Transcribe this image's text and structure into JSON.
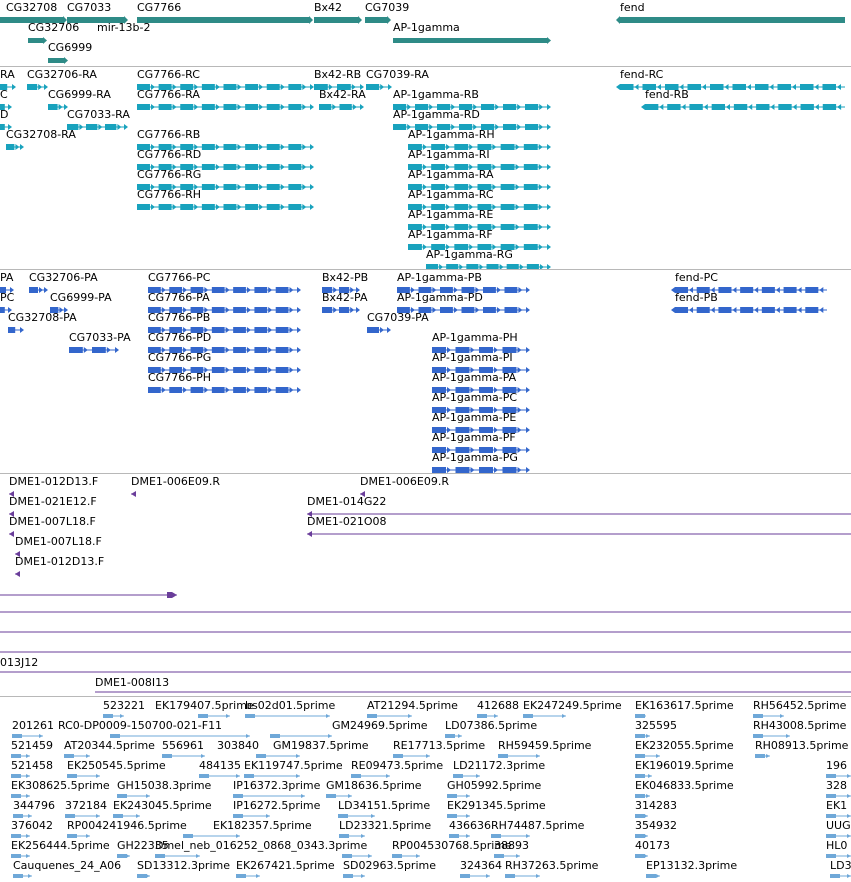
{
  "colors": {
    "gene": "#2e8b87",
    "transcript": "#18a2bd",
    "protein": "#3366cc",
    "clone": "#6a3d9a",
    "est": "#6fa8d8"
  },
  "tracks": {
    "genes": {
      "labels": [
        {
          "t": "CG32708"
        },
        {
          "t": "CG7033"
        },
        {
          "t": "CG7766"
        },
        {
          "t": "Bx42"
        },
        {
          "t": "CG7039"
        },
        {
          "t": "fend"
        },
        {
          "t": "CG32706"
        },
        {
          "t": "mir-13b-2"
        },
        {
          "t": "AP-1gamma"
        },
        {
          "t": "CG6999"
        }
      ]
    },
    "transcripts": {
      "labels": [
        {
          "t": "RA"
        },
        {
          "t": "CG32706-RA"
        },
        {
          "t": "CG7766-RC"
        },
        {
          "t": "Bx42-RB"
        },
        {
          "t": "CG7039-RA"
        },
        {
          "t": "fend-RC"
        },
        {
          "t": "C"
        },
        {
          "t": "CG6999-RA"
        },
        {
          "t": "CG7766-RA"
        },
        {
          "t": "Bx42-RA"
        },
        {
          "t": "AP-1gamma-RB"
        },
        {
          "t": "fend-RB"
        },
        {
          "t": "D"
        },
        {
          "t": "CG7033-RA"
        },
        {
          "t": "AP-1gamma-RD"
        },
        {
          "t": "CG32708-RA"
        },
        {
          "t": "CG7766-RB"
        },
        {
          "t": "AP-1gamma-RH"
        },
        {
          "t": "CG7766-RD"
        },
        {
          "t": "AP-1gamma-RI"
        },
        {
          "t": "CG7766-RG"
        },
        {
          "t": "AP-1gamma-RA"
        },
        {
          "t": "CG7766-RH"
        },
        {
          "t": "AP-1gamma-RC"
        },
        {
          "t": "AP-1gamma-RE"
        },
        {
          "t": "AP-1gamma-RF"
        },
        {
          "t": "AP-1gamma-RG"
        }
      ]
    },
    "proteins": {
      "labels": [
        {
          "t": "PA"
        },
        {
          "t": "CG32706-PA"
        },
        {
          "t": "CG7766-PC"
        },
        {
          "t": "Bx42-PB"
        },
        {
          "t": "AP-1gamma-PB"
        },
        {
          "t": "fend-PC"
        },
        {
          "t": "PC"
        },
        {
          "t": "CG6999-PA"
        },
        {
          "t": "CG7766-PA"
        },
        {
          "t": "Bx42-PA"
        },
        {
          "t": "AP-1gamma-PD"
        },
        {
          "t": "fend-PB"
        },
        {
          "t": "CG32708-PA"
        },
        {
          "t": "CG7766-PB"
        },
        {
          "t": "CG7039-PA"
        },
        {
          "t": "CG7033-PA"
        },
        {
          "t": "CG7766-PD"
        },
        {
          "t": "AP-1gamma-PH"
        },
        {
          "t": "CG7766-PG"
        },
        {
          "t": "AP-1gamma-PI"
        },
        {
          "t": "CG7766-PH"
        },
        {
          "t": "AP-1gamma-PA"
        },
        {
          "t": "AP-1gamma-PC"
        },
        {
          "t": "AP-1gamma-PE"
        },
        {
          "t": "AP-1gamma-PF"
        },
        {
          "t": "AP-1gamma-PG"
        }
      ]
    },
    "clones": {
      "labels": [
        {
          "t": "DME1-012D13.F"
        },
        {
          "t": "DME1-006E09.R"
        },
        {
          "t": "DME1-006E09.R"
        },
        {
          "t": "DME1-021E12.F"
        },
        {
          "t": "DME1-014G22"
        },
        {
          "t": "DME1-007L18.F"
        },
        {
          "t": "DME1-021O08"
        },
        {
          "t": "DME1-007L18.F"
        },
        {
          "t": "DME1-012D13.F"
        },
        {
          "t": "013J12"
        },
        {
          "t": "DME1-008I13"
        }
      ]
    },
    "ests": {
      "labels": [
        {
          "t": "523221"
        },
        {
          "t": "EK179407.5prime"
        },
        {
          "t": "bs02d01.5prime"
        },
        {
          "t": "AT21294.5prime"
        },
        {
          "t": "412688"
        },
        {
          "t": "EK247249.5prime"
        },
        {
          "t": "EK163617.5prime"
        },
        {
          "t": "RH56452.5prime"
        },
        {
          "t": "201261"
        },
        {
          "t": "RC0-DP0009-150700-021-F11"
        },
        {
          "t": "GM24969.5prime"
        },
        {
          "t": "LD07386.5prime"
        },
        {
          "t": "325595"
        },
        {
          "t": "RH43008.5prime"
        },
        {
          "t": "521459"
        },
        {
          "t": "AT20344.5prime"
        },
        {
          "t": "556961"
        },
        {
          "t": "303840"
        },
        {
          "t": "GM19837.5prime"
        },
        {
          "t": "RE17713.5prime"
        },
        {
          "t": "RH59459.5prime"
        },
        {
          "t": "EK232055.5prime"
        },
        {
          "t": "RH08913.5prime"
        },
        {
          "t": "521458"
        },
        {
          "t": "EK250545.5prime"
        },
        {
          "t": "484135"
        },
        {
          "t": "EK119747.5prime"
        },
        {
          "t": "RE09473.5prime"
        },
        {
          "t": "LD21172.3prime"
        },
        {
          "t": "EK196019.5prime"
        },
        {
          "t": "196"
        },
        {
          "t": "EK308625.5prime"
        },
        {
          "t": "GH15038.3prime"
        },
        {
          "t": "IP16372.3prime"
        },
        {
          "t": "GM18636.5prime"
        },
        {
          "t": "GH05992.5prime"
        },
        {
          "t": "EK046833.5prime"
        },
        {
          "t": "328"
        },
        {
          "t": "344796"
        },
        {
          "t": "372184"
        },
        {
          "t": "EK243045.5prime"
        },
        {
          "t": "IP16272.5prime"
        },
        {
          "t": "LD34151.5prime"
        },
        {
          "t": "EK291345.5prime"
        },
        {
          "t": "314283"
        },
        {
          "t": "EK1"
        },
        {
          "t": "376042"
        },
        {
          "t": "RP004241946.5prime"
        },
        {
          "t": "EK182357.5prime"
        },
        {
          "t": "LD23321.5prime"
        },
        {
          "t": "436636"
        },
        {
          "t": "RH74487.5prime"
        },
        {
          "t": "354932"
        },
        {
          "t": "UUG"
        },
        {
          "t": "EK256444.5prime"
        },
        {
          "t": "GH22335"
        },
        {
          "t": "Dmel_neb_016252_0868_0343.3prime"
        },
        {
          "t": "RP004530768.5prime"
        },
        {
          "t": "38893"
        },
        {
          "t": "40173"
        },
        {
          "t": "HL0"
        },
        {
          "t": "Cauquenes_24_A06"
        },
        {
          "t": "SD13312.3prime"
        },
        {
          "t": "EK267421.5prime"
        },
        {
          "t": "SD02963.5prime"
        },
        {
          "t": "324364"
        },
        {
          "t": "RH37263.5prime"
        },
        {
          "t": "EP13132.3prime"
        },
        {
          "t": "LD3"
        }
      ]
    }
  }
}
